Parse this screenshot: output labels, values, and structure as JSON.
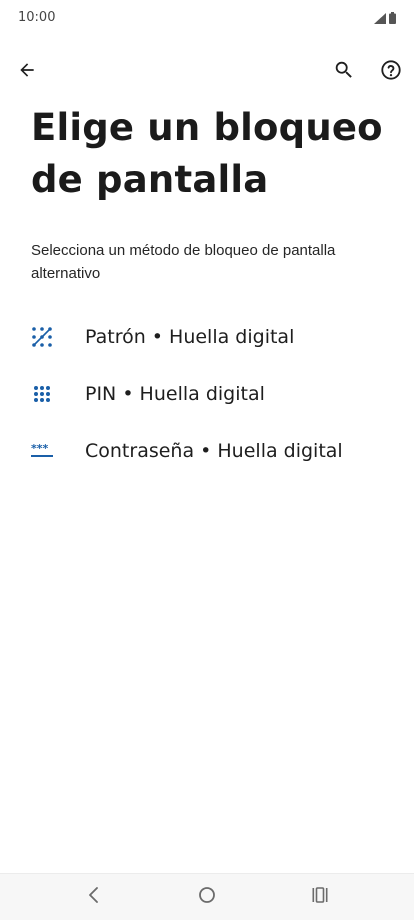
{
  "status_bar": {
    "time": "10:00",
    "icons": [
      "signal-icon",
      "battery-icon"
    ]
  },
  "toolbar": {
    "back_icon": "arrow-back-icon",
    "search_icon": "search-icon",
    "help_icon": "help-circle-icon"
  },
  "page": {
    "title": "Elige un bloqueo de pantalla",
    "subtitle": "Selecciona un método de bloqueo de pantalla alternativo"
  },
  "options": [
    {
      "label": "Patrón • Huella digital",
      "icon": "pattern-icon"
    },
    {
      "label": "PIN • Huella digital",
      "icon": "pin-keypad-icon"
    },
    {
      "label": "Contraseña • Huella digital",
      "icon": "password-icon"
    }
  ],
  "nav_bar": {
    "back_icon": "nav-back-icon",
    "home_icon": "nav-home-icon",
    "recents_icon": "nav-recents-icon"
  },
  "colors": {
    "accent": "#1a5fa8",
    "text": "#1f1f1f",
    "nav_icon": "#6b6b6b"
  }
}
